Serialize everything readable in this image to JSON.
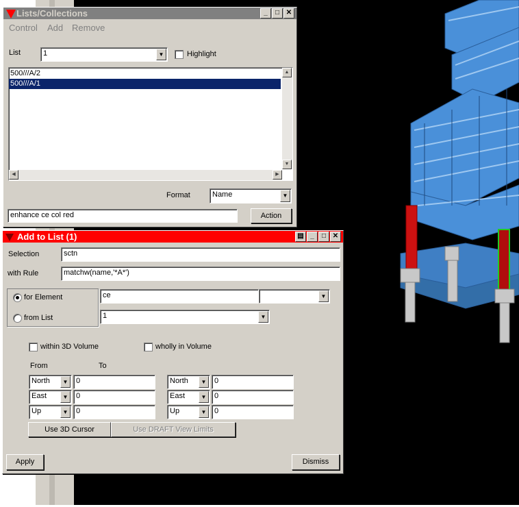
{
  "lists_window": {
    "title": "Lists/Collections",
    "menu": [
      "Control",
      "Add",
      "Remove"
    ],
    "list_label": "List",
    "list_value": "1",
    "highlight_label": "Highlight",
    "items": [
      "500///A/2",
      "500///A/1"
    ],
    "selected_index": 1,
    "format_label": "Format",
    "format_value": "Name",
    "command_value": "enhance ce col red",
    "action_label": "Action"
  },
  "add_window": {
    "title": "Add to List (1)",
    "selection_label": "Selection",
    "selection_value": "sctn",
    "rule_label": "with Rule",
    "rule_value": "matchw(name,'*A*')",
    "for_element_label": "for Element",
    "for_element_value": "ce",
    "from_list_label": "from List",
    "from_list_value": "1",
    "within_volume_label": "within 3D Volume",
    "wholly_label": "wholly in Volume",
    "from_label": "From",
    "to_label": "To",
    "from_rows": [
      {
        "dir": "North",
        "value": "0"
      },
      {
        "dir": "East",
        "value": "0"
      },
      {
        "dir": "Up",
        "value": "0"
      }
    ],
    "to_rows": [
      {
        "dir": "North",
        "value": "0"
      },
      {
        "dir": "East",
        "value": "0"
      },
      {
        "dir": "Up",
        "value": "0"
      }
    ],
    "cursor_button": "Use 3D Cursor",
    "draft_button": "Use DRAFT View Limits",
    "apply_label": "Apply",
    "dismiss_label": "Dismiss"
  },
  "colors": {
    "lists_title_bg": "#808080",
    "add_title_bg": "#ff0000",
    "selection_bg": "#0a246a",
    "steel": "#4a90d9",
    "highlight": "#cc1111"
  }
}
